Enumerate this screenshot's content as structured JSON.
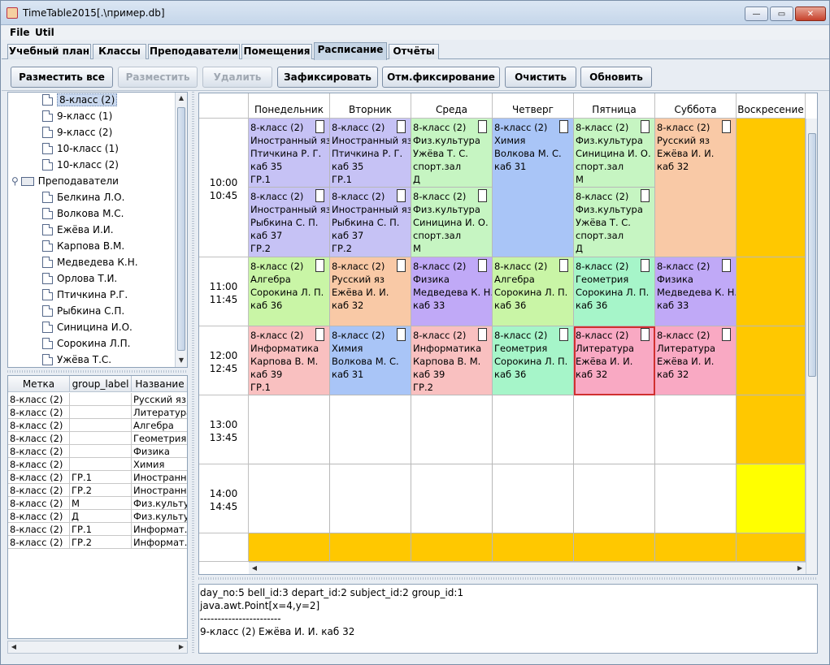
{
  "window": {
    "title": "TimeTable2015[.\\пример.db]",
    "min": "—",
    "max": "▭",
    "close": "✕"
  },
  "menu": [
    "File",
    "Util"
  ],
  "tabs": [
    {
      "label": "Учебный план"
    },
    {
      "label": "Классы"
    },
    {
      "label": "Преподаватели"
    },
    {
      "label": "Помещения"
    },
    {
      "label": "Расписание",
      "active": true
    },
    {
      "label": "Отчёты"
    }
  ],
  "toolbar": {
    "place_all": "Разместить все",
    "place": "Разместить",
    "delete": "Удалить",
    "fix": "Зафиксировать",
    "unfix": "Отм.фиксирование",
    "clear": "Очистить",
    "refresh": "Обновить"
  },
  "tree": {
    "classes": [
      "8-класс (2)",
      "9-класс (1)",
      "9-класс (2)",
      "10-класс (1)",
      "10-класс (2)"
    ],
    "teachers_folder": "Преподаватели",
    "teachers": [
      "Белкина Л.О.",
      "Волкова М.С.",
      "Ежёва И.И.",
      "Карпова В.М.",
      "Медведева К.Н.",
      "Орлова Т.И.",
      "Птичкина Р.Г.",
      "Рыбкина С.П.",
      "Синицина И.О.",
      "Сорокина Л.П.",
      "Ужёва Т.С."
    ]
  },
  "left_table": {
    "headers": [
      "Метка",
      "group_label",
      "Название"
    ],
    "rows": [
      [
        "8-класс (2)",
        "",
        "Русский яз"
      ],
      [
        "8-класс (2)",
        "",
        "Литература"
      ],
      [
        "8-класс (2)",
        "",
        "Алгебра"
      ],
      [
        "8-класс (2)",
        "",
        "Геометрия"
      ],
      [
        "8-класс (2)",
        "",
        "Физика"
      ],
      [
        "8-класс (2)",
        "",
        "Химия"
      ],
      [
        "8-класс (2)",
        "ГР.1",
        "Иностранн..."
      ],
      [
        "8-класс (2)",
        "ГР.2",
        "Иностранн..."
      ],
      [
        "8-класс (2)",
        "М",
        "Физ.культу..."
      ],
      [
        "8-класс (2)",
        "Д",
        "Физ.культу..."
      ],
      [
        "8-класс (2)",
        "ГР.1",
        "Информат..."
      ],
      [
        "8-класс (2)",
        "ГР.2",
        "Информат..."
      ]
    ]
  },
  "schedule": {
    "days": [
      "Понедельник",
      "Вторник",
      "Среда",
      "Четверг",
      "Пятница",
      "Суббота",
      "Воскресение"
    ],
    "times": [
      [
        "10:00",
        "10:45"
      ],
      [
        "11:00",
        "11:45"
      ],
      [
        "12:00",
        "12:45"
      ],
      [
        "13:00",
        "13:45"
      ],
      [
        "14:00",
        "14:45"
      ]
    ],
    "colors": {
      "purple": "#c6c2f5",
      "green": "#c6f5c2",
      "blue": "#a9c5f7",
      "orange": "#f9c9a6",
      "lime": "#c9f5a6",
      "violet": "#c0a9f7",
      "mint": "#a6f5c9",
      "pink": "#f9a9c3",
      "rose": "#f9c0c0",
      "sunday": "#ffc800",
      "sunday_hl": "#ffff00"
    },
    "lessons": [
      {
        "lines": [
          "8-класс (2)",
          "Иностранный яз.",
          "Птичкина Р. Г.",
          "каб 35",
          "ГР.1"
        ],
        "color": "purple",
        "check": true
      },
      {
        "lines": [
          "8-класс (2)",
          "Иностранный яз.",
          "Рыбкина С. П.",
          "каб 37",
          "ГР.2"
        ],
        "color": "purple",
        "check": true
      },
      {
        "lines": [
          "8-класс (2)",
          "Иностранный яз.",
          "Птичкина Р. Г.",
          "каб 35",
          "ГР.1"
        ],
        "color": "purple",
        "check": true
      },
      {
        "lines": [
          "8-класс (2)",
          "Иностранный яз.",
          "Рыбкина С. П.",
          "каб 37",
          "ГР.2"
        ],
        "color": "purple",
        "check": true
      },
      {
        "lines": [
          "8-класс (2)",
          "Физ.культура",
          "Ужёва Т. С.",
          "спорт.зал",
          "Д"
        ],
        "color": "green",
        "check": true
      },
      {
        "lines": [
          "8-класс (2)",
          "Физ.культура",
          "Синицина И. О.",
          "спорт.зал",
          "М"
        ],
        "color": "green",
        "check": true
      },
      {
        "lines": [
          "8-класс (2)",
          "Химия",
          "Волкова М. С.",
          "каб 31"
        ],
        "color": "blue",
        "check": true
      },
      {
        "lines": [
          "8-класс (2)",
          "Физ.культура",
          "Синицина И. О.",
          "спорт.зал",
          "М"
        ],
        "color": "green",
        "check": true
      },
      {
        "lines": [
          "8-класс (2)",
          "Физ.культура",
          "Ужёва Т. С.",
          "спорт.зал",
          "Д"
        ],
        "color": "green",
        "check": true
      },
      {
        "lines": [
          "8-класс (2)",
          "Русский яз",
          "Ежёва И. И.",
          "каб 32"
        ],
        "color": "orange",
        "check": true
      },
      {
        "lines": [
          "8-класс (2)",
          "Алгебра",
          "Сорокина Л. П.",
          "каб 36"
        ],
        "color": "lime",
        "check": true
      },
      {
        "lines": [
          "8-класс (2)",
          "Русский яз",
          "Ежёва И. И.",
          "каб 32"
        ],
        "color": "orange",
        "check": true
      },
      {
        "lines": [
          "8-класс (2)",
          "Физика",
          "Медведева К. Н.",
          "каб 33"
        ],
        "color": "violet",
        "check": true
      },
      {
        "lines": [
          "8-класс (2)",
          "Алгебра",
          "Сорокина Л. П.",
          "каб 36"
        ],
        "color": "lime",
        "check": true
      },
      {
        "lines": [
          "8-класс (2)",
          "Геометрия",
          "Сорокина Л. П.",
          "каб 36"
        ],
        "color": "mint",
        "check": true
      },
      {
        "lines": [
          "8-класс (2)",
          "Физика",
          "Медведева К. Н.",
          "каб 33"
        ],
        "color": "violet",
        "check": true
      },
      {
        "lines": [
          "8-класс (2)",
          "Информатика",
          "Карпова В. М.",
          "каб 39",
          "ГР.1"
        ],
        "color": "rose",
        "check": true
      },
      {
        "lines": [
          "8-класс (2)",
          "Химия",
          "Волкова М. С.",
          "каб 31"
        ],
        "color": "blue",
        "check": true
      },
      {
        "lines": [
          "8-класс (2)",
          "Информатика",
          "Карпова В. М.",
          "каб 39",
          "ГР.2"
        ],
        "color": "rose",
        "check": true
      },
      {
        "lines": [
          "8-класс (2)",
          "Геометрия",
          "Сорокина Л. П.",
          "каб 36"
        ],
        "color": "mint",
        "check": true
      },
      {
        "lines": [
          "8-класс (2)",
          "Литература",
          "Ежёва И. И.",
          "каб 32"
        ],
        "color": "pink",
        "check": true,
        "selected": true
      },
      {
        "lines": [
          "8-класс (2)",
          "Литература",
          "Ежёва И. И.",
          "каб 32"
        ],
        "color": "pink",
        "check": true
      }
    ]
  },
  "detail": {
    "lines": [
      "day_no:5 bell_id:3 depart_id:2 subject_id:2 group_id:1",
      "java.awt.Point[x=4,y=2]",
      "-----------------------",
      "9-класс (2)  Ежёва И. И. каб 32"
    ]
  }
}
